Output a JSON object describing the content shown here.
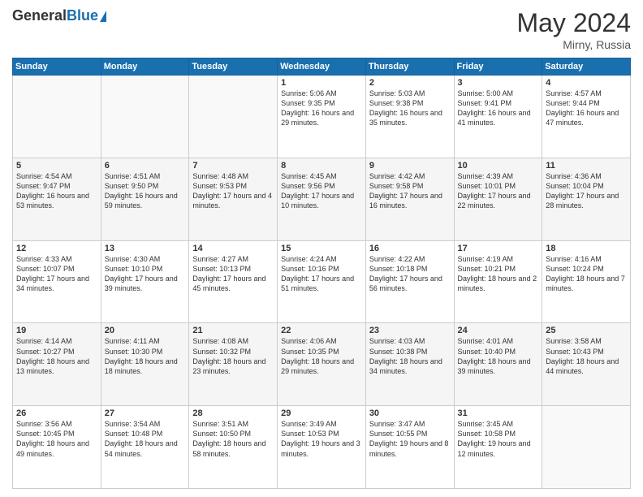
{
  "logo": {
    "general": "General",
    "blue": "Blue"
  },
  "title": {
    "month_year": "May 2024",
    "location": "Mirny, Russia"
  },
  "days_of_week": [
    "Sunday",
    "Monday",
    "Tuesday",
    "Wednesday",
    "Thursday",
    "Friday",
    "Saturday"
  ],
  "weeks": [
    [
      {
        "num": "",
        "sunrise": "",
        "sunset": "",
        "daylight": "",
        "empty": true
      },
      {
        "num": "",
        "sunrise": "",
        "sunset": "",
        "daylight": "",
        "empty": true
      },
      {
        "num": "",
        "sunrise": "",
        "sunset": "",
        "daylight": "",
        "empty": true
      },
      {
        "num": "1",
        "sunrise": "Sunrise: 5:06 AM",
        "sunset": "Sunset: 9:35 PM",
        "daylight": "Daylight: 16 hours and 29 minutes."
      },
      {
        "num": "2",
        "sunrise": "Sunrise: 5:03 AM",
        "sunset": "Sunset: 9:38 PM",
        "daylight": "Daylight: 16 hours and 35 minutes."
      },
      {
        "num": "3",
        "sunrise": "Sunrise: 5:00 AM",
        "sunset": "Sunset: 9:41 PM",
        "daylight": "Daylight: 16 hours and 41 minutes."
      },
      {
        "num": "4",
        "sunrise": "Sunrise: 4:57 AM",
        "sunset": "Sunset: 9:44 PM",
        "daylight": "Daylight: 16 hours and 47 minutes."
      }
    ],
    [
      {
        "num": "5",
        "sunrise": "Sunrise: 4:54 AM",
        "sunset": "Sunset: 9:47 PM",
        "daylight": "Daylight: 16 hours and 53 minutes."
      },
      {
        "num": "6",
        "sunrise": "Sunrise: 4:51 AM",
        "sunset": "Sunset: 9:50 PM",
        "daylight": "Daylight: 16 hours and 59 minutes."
      },
      {
        "num": "7",
        "sunrise": "Sunrise: 4:48 AM",
        "sunset": "Sunset: 9:53 PM",
        "daylight": "Daylight: 17 hours and 4 minutes."
      },
      {
        "num": "8",
        "sunrise": "Sunrise: 4:45 AM",
        "sunset": "Sunset: 9:56 PM",
        "daylight": "Daylight: 17 hours and 10 minutes."
      },
      {
        "num": "9",
        "sunrise": "Sunrise: 4:42 AM",
        "sunset": "Sunset: 9:58 PM",
        "daylight": "Daylight: 17 hours and 16 minutes."
      },
      {
        "num": "10",
        "sunrise": "Sunrise: 4:39 AM",
        "sunset": "Sunset: 10:01 PM",
        "daylight": "Daylight: 17 hours and 22 minutes."
      },
      {
        "num": "11",
        "sunrise": "Sunrise: 4:36 AM",
        "sunset": "Sunset: 10:04 PM",
        "daylight": "Daylight: 17 hours and 28 minutes."
      }
    ],
    [
      {
        "num": "12",
        "sunrise": "Sunrise: 4:33 AM",
        "sunset": "Sunset: 10:07 PM",
        "daylight": "Daylight: 17 hours and 34 minutes."
      },
      {
        "num": "13",
        "sunrise": "Sunrise: 4:30 AM",
        "sunset": "Sunset: 10:10 PM",
        "daylight": "Daylight: 17 hours and 39 minutes."
      },
      {
        "num": "14",
        "sunrise": "Sunrise: 4:27 AM",
        "sunset": "Sunset: 10:13 PM",
        "daylight": "Daylight: 17 hours and 45 minutes."
      },
      {
        "num": "15",
        "sunrise": "Sunrise: 4:24 AM",
        "sunset": "Sunset: 10:16 PM",
        "daylight": "Daylight: 17 hours and 51 minutes."
      },
      {
        "num": "16",
        "sunrise": "Sunrise: 4:22 AM",
        "sunset": "Sunset: 10:18 PM",
        "daylight": "Daylight: 17 hours and 56 minutes."
      },
      {
        "num": "17",
        "sunrise": "Sunrise: 4:19 AM",
        "sunset": "Sunset: 10:21 PM",
        "daylight": "Daylight: 18 hours and 2 minutes."
      },
      {
        "num": "18",
        "sunrise": "Sunrise: 4:16 AM",
        "sunset": "Sunset: 10:24 PM",
        "daylight": "Daylight: 18 hours and 7 minutes."
      }
    ],
    [
      {
        "num": "19",
        "sunrise": "Sunrise: 4:14 AM",
        "sunset": "Sunset: 10:27 PM",
        "daylight": "Daylight: 18 hours and 13 minutes."
      },
      {
        "num": "20",
        "sunrise": "Sunrise: 4:11 AM",
        "sunset": "Sunset: 10:30 PM",
        "daylight": "Daylight: 18 hours and 18 minutes."
      },
      {
        "num": "21",
        "sunrise": "Sunrise: 4:08 AM",
        "sunset": "Sunset: 10:32 PM",
        "daylight": "Daylight: 18 hours and 23 minutes."
      },
      {
        "num": "22",
        "sunrise": "Sunrise: 4:06 AM",
        "sunset": "Sunset: 10:35 PM",
        "daylight": "Daylight: 18 hours and 29 minutes."
      },
      {
        "num": "23",
        "sunrise": "Sunrise: 4:03 AM",
        "sunset": "Sunset: 10:38 PM",
        "daylight": "Daylight: 18 hours and 34 minutes."
      },
      {
        "num": "24",
        "sunrise": "Sunrise: 4:01 AM",
        "sunset": "Sunset: 10:40 PM",
        "daylight": "Daylight: 18 hours and 39 minutes."
      },
      {
        "num": "25",
        "sunrise": "Sunrise: 3:58 AM",
        "sunset": "Sunset: 10:43 PM",
        "daylight": "Daylight: 18 hours and 44 minutes."
      }
    ],
    [
      {
        "num": "26",
        "sunrise": "Sunrise: 3:56 AM",
        "sunset": "Sunset: 10:45 PM",
        "daylight": "Daylight: 18 hours and 49 minutes."
      },
      {
        "num": "27",
        "sunrise": "Sunrise: 3:54 AM",
        "sunset": "Sunset: 10:48 PM",
        "daylight": "Daylight: 18 hours and 54 minutes."
      },
      {
        "num": "28",
        "sunrise": "Sunrise: 3:51 AM",
        "sunset": "Sunset: 10:50 PM",
        "daylight": "Daylight: 18 hours and 58 minutes."
      },
      {
        "num": "29",
        "sunrise": "Sunrise: 3:49 AM",
        "sunset": "Sunset: 10:53 PM",
        "daylight": "Daylight: 19 hours and 3 minutes."
      },
      {
        "num": "30",
        "sunrise": "Sunrise: 3:47 AM",
        "sunset": "Sunset: 10:55 PM",
        "daylight": "Daylight: 19 hours and 8 minutes."
      },
      {
        "num": "31",
        "sunrise": "Sunrise: 3:45 AM",
        "sunset": "Sunset: 10:58 PM",
        "daylight": "Daylight: 19 hours and 12 minutes."
      },
      {
        "num": "",
        "sunrise": "",
        "sunset": "",
        "daylight": "",
        "empty": true
      }
    ]
  ]
}
